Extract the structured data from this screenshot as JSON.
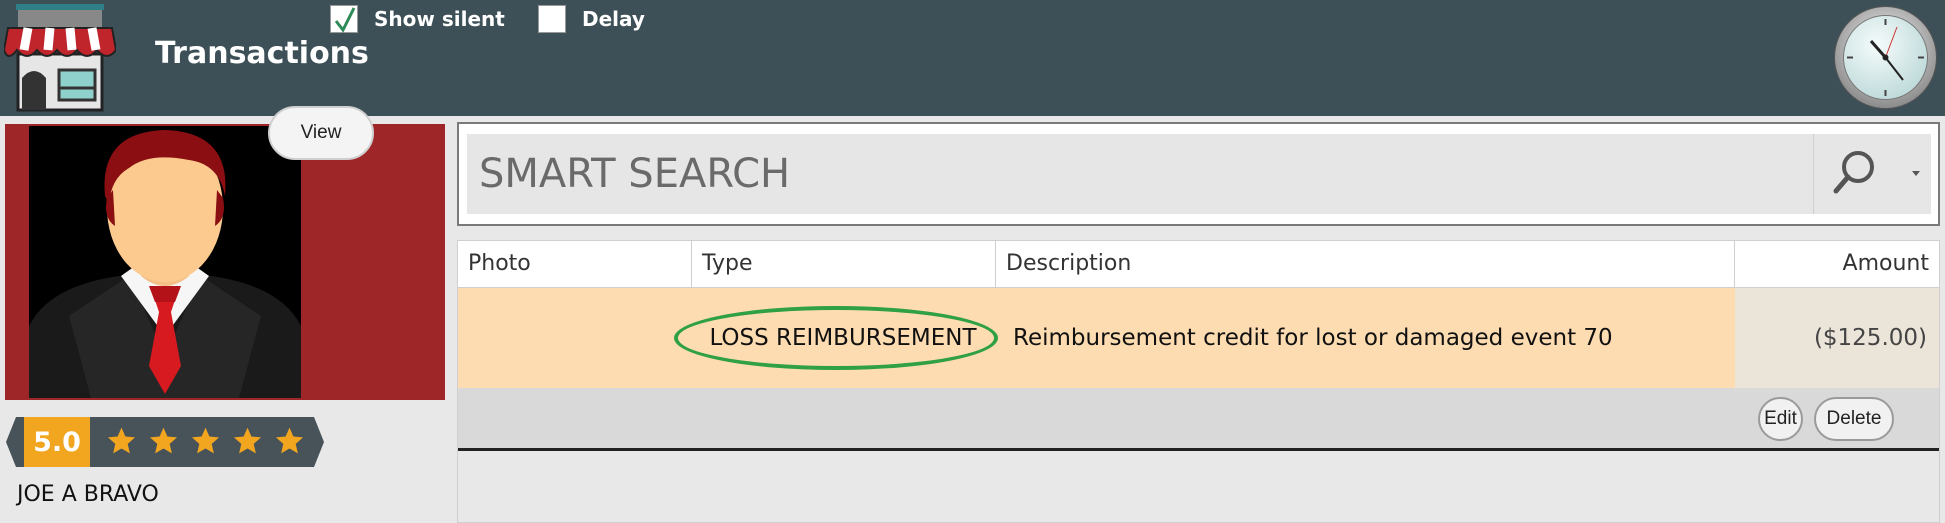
{
  "header": {
    "title": "Transactions",
    "options": {
      "show_silent": {
        "label": "Show silent",
        "checked": true
      },
      "delay": {
        "label": "Delay",
        "checked": false
      }
    }
  },
  "profile": {
    "view_button": "View",
    "rating": "5.0",
    "stars": 5,
    "name": "JOE A BRAVO"
  },
  "search": {
    "placeholder": "SMART SEARCH"
  },
  "table": {
    "columns": [
      "Photo",
      "Type",
      "Description",
      "Amount"
    ],
    "rows": [
      {
        "photo": "",
        "type": "LOSS REIMBURSEMENT",
        "description": "Reimbursement credit for lost or damaged event 70",
        "amount": "($125.00)"
      }
    ],
    "actions": {
      "edit": "Edit",
      "delete": "Delete"
    }
  },
  "colors": {
    "header_bg": "#3d5058",
    "photo_panel_bg": "#9e2628",
    "rating_accent": "#f2a51f",
    "row_highlight": "#fedcb2",
    "type_oval": "#2fa044"
  }
}
